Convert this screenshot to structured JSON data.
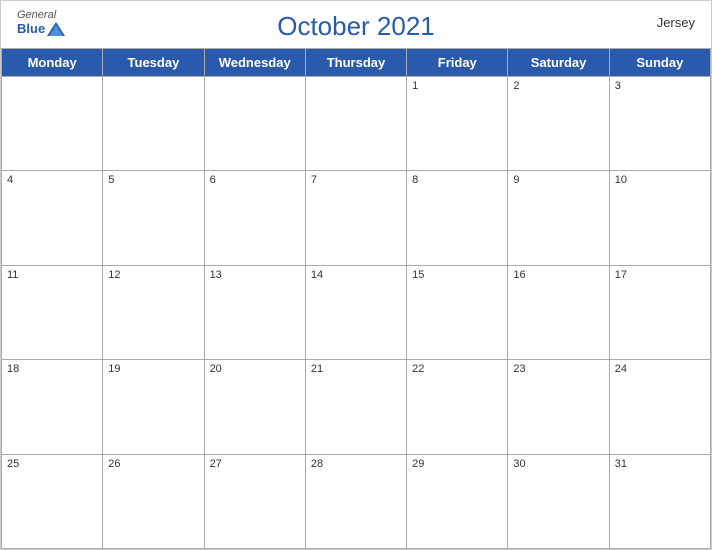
{
  "header": {
    "brand_general": "General",
    "brand_blue": "Blue",
    "title": "October 2021",
    "region": "Jersey"
  },
  "days": [
    "Monday",
    "Tuesday",
    "Wednesday",
    "Thursday",
    "Friday",
    "Saturday",
    "Sunday"
  ],
  "weeks": [
    [
      {
        "num": "",
        "empty": true
      },
      {
        "num": "",
        "empty": true
      },
      {
        "num": "",
        "empty": true
      },
      {
        "num": "",
        "empty": true
      },
      {
        "num": "1",
        "empty": false
      },
      {
        "num": "2",
        "empty": false
      },
      {
        "num": "3",
        "empty": false
      }
    ],
    [
      {
        "num": "4",
        "empty": false
      },
      {
        "num": "5",
        "empty": false
      },
      {
        "num": "6",
        "empty": false
      },
      {
        "num": "7",
        "empty": false
      },
      {
        "num": "8",
        "empty": false
      },
      {
        "num": "9",
        "empty": false
      },
      {
        "num": "10",
        "empty": false
      }
    ],
    [
      {
        "num": "11",
        "empty": false
      },
      {
        "num": "12",
        "empty": false
      },
      {
        "num": "13",
        "empty": false
      },
      {
        "num": "14",
        "empty": false
      },
      {
        "num": "15",
        "empty": false
      },
      {
        "num": "16",
        "empty": false
      },
      {
        "num": "17",
        "empty": false
      }
    ],
    [
      {
        "num": "18",
        "empty": false
      },
      {
        "num": "19",
        "empty": false
      },
      {
        "num": "20",
        "empty": false
      },
      {
        "num": "21",
        "empty": false
      },
      {
        "num": "22",
        "empty": false
      },
      {
        "num": "23",
        "empty": false
      },
      {
        "num": "24",
        "empty": false
      }
    ],
    [
      {
        "num": "25",
        "empty": false
      },
      {
        "num": "26",
        "empty": false
      },
      {
        "num": "27",
        "empty": false
      },
      {
        "num": "28",
        "empty": false
      },
      {
        "num": "29",
        "empty": false
      },
      {
        "num": "30",
        "empty": false
      },
      {
        "num": "31",
        "empty": false
      }
    ]
  ]
}
